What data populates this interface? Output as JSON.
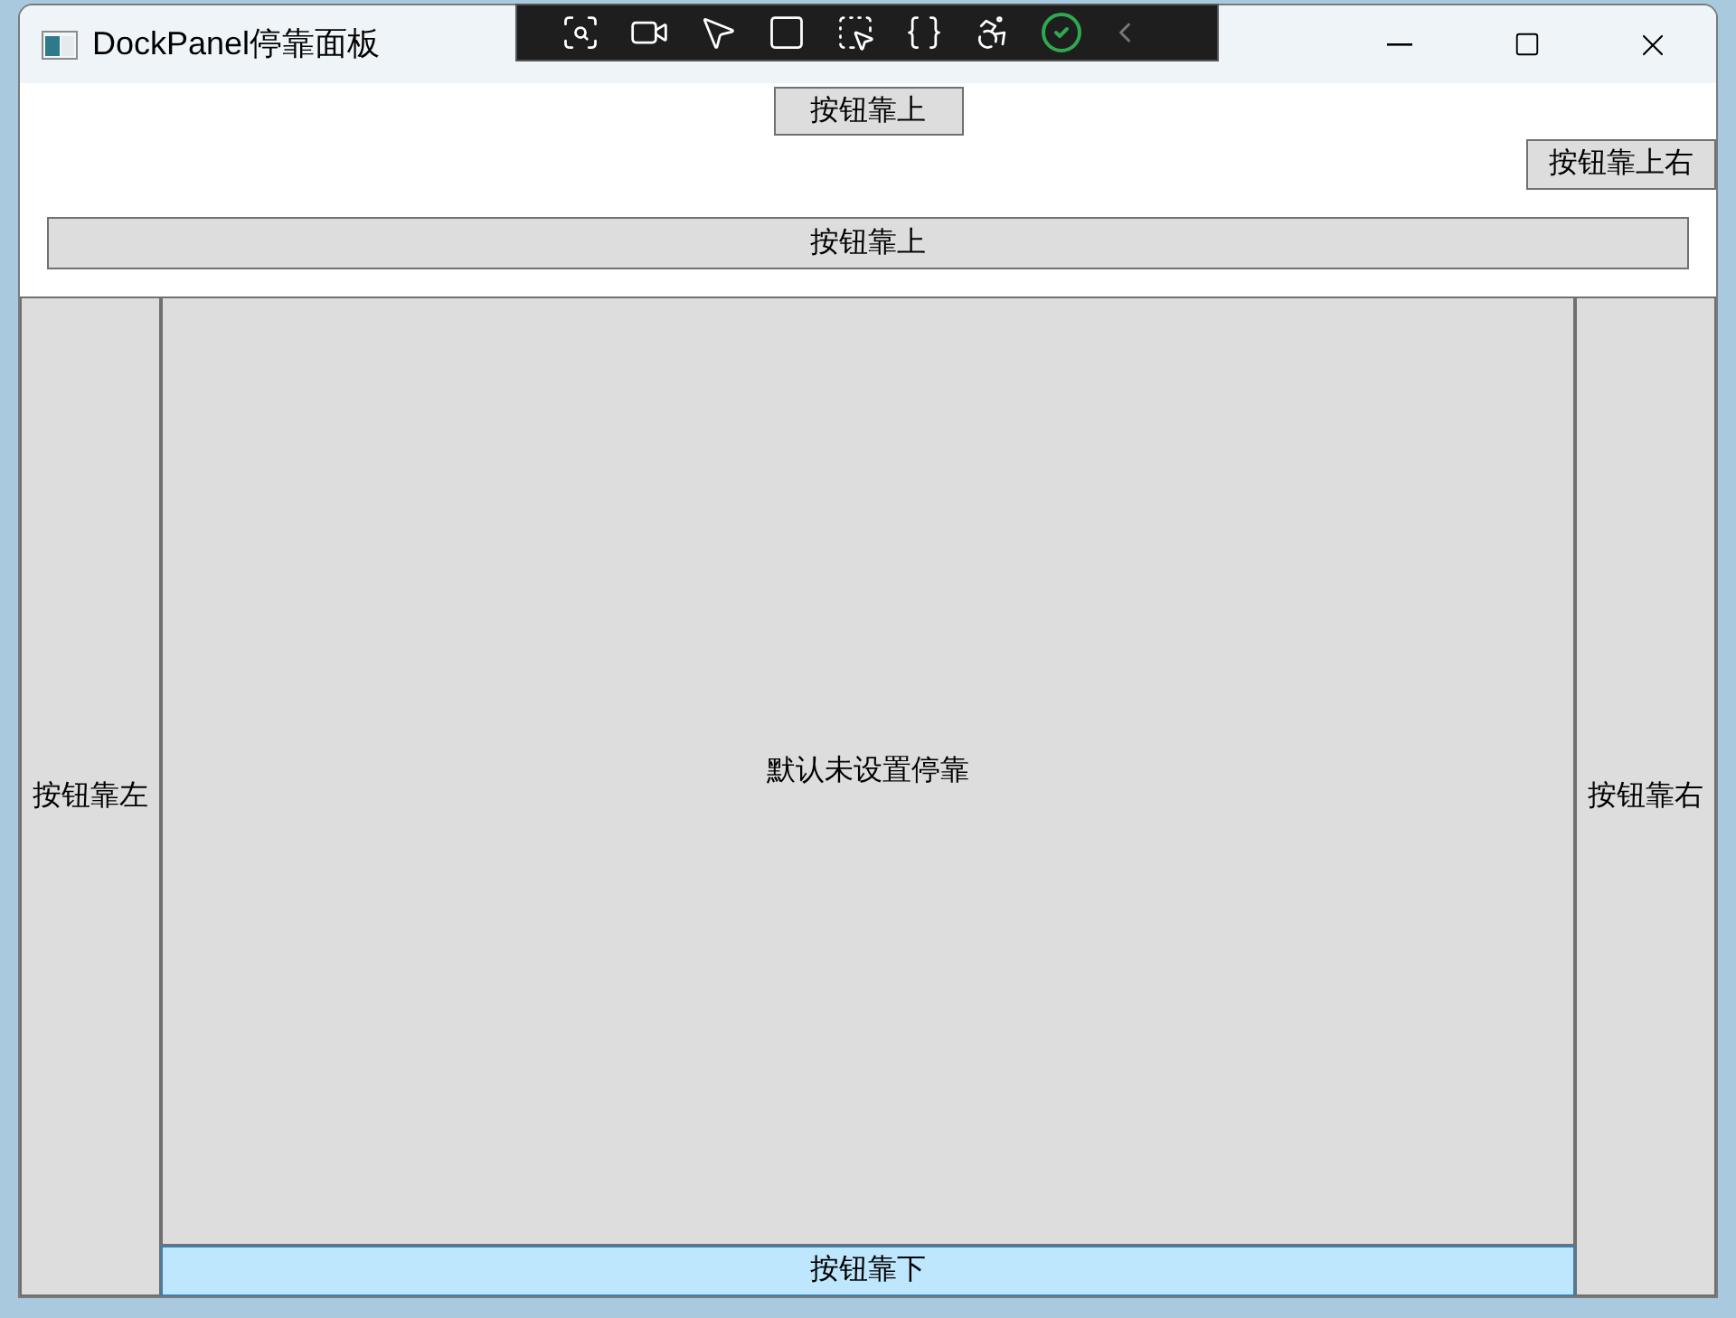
{
  "window": {
    "title": "DockPanel停靠面板"
  },
  "buttons": [
    {
      "kind": "top",
      "label": "按钮靠上",
      "highlighted": false
    },
    {
      "kind": "top_right",
      "label": "按钮靠上右",
      "highlighted": false
    },
    {
      "kind": "top_stretch",
      "label": "按钮靠上",
      "highlighted": false
    },
    {
      "kind": "left",
      "label": "按钮靠左",
      "highlighted": false
    },
    {
      "kind": "right",
      "label": "按钮靠右",
      "highlighted": false
    },
    {
      "kind": "fill",
      "label": "默认未设置停靠",
      "highlighted": false
    },
    {
      "kind": "bottom",
      "label": "按钮靠下",
      "highlighted": true
    }
  ]
}
